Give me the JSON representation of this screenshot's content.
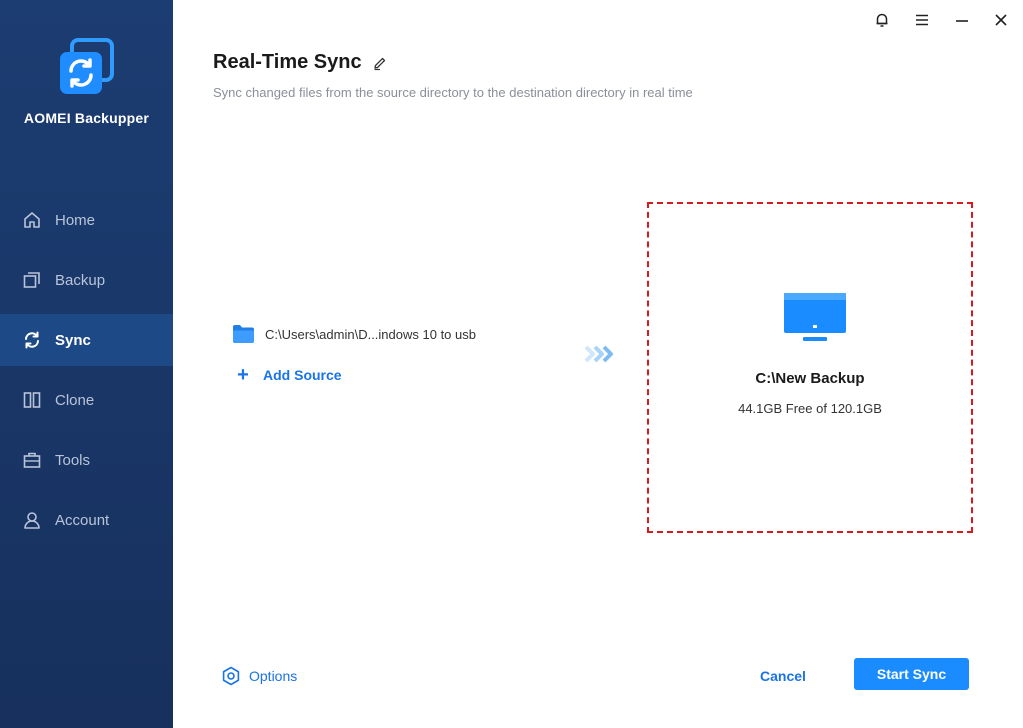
{
  "sidebar": {
    "app_name": "AOMEI Backupper",
    "items": [
      {
        "label": "Home",
        "icon": "home-icon"
      },
      {
        "label": "Backup",
        "icon": "backup-icon"
      },
      {
        "label": "Sync",
        "icon": "sync-icon",
        "active": true
      },
      {
        "label": "Clone",
        "icon": "clone-icon"
      },
      {
        "label": "Tools",
        "icon": "tools-icon"
      },
      {
        "label": "Account",
        "icon": "account-icon"
      }
    ]
  },
  "window_controls": [
    "bell-icon",
    "menu-icon",
    "minimize-icon",
    "close-icon"
  ],
  "header": {
    "title": "Real-Time Sync",
    "subtitle": "Sync changed files from the source directory to the destination directory in real time"
  },
  "source": {
    "path": "C:\\Users\\admin\\D...indows 10 to usb",
    "add_label": "Add Source"
  },
  "destination": {
    "name": "C:\\New Backup",
    "free": "44.1GB Free of 120.1GB"
  },
  "footer": {
    "options_label": "Options",
    "cancel_label": "Cancel",
    "start_label": "Start Sync"
  },
  "colors": {
    "sidebar_bg": "#1a3a6e",
    "sidebar_active": "#1d4a86",
    "accent": "#1a73e8",
    "primary_button": "#1a8cff",
    "dest_border": "#d71920"
  }
}
